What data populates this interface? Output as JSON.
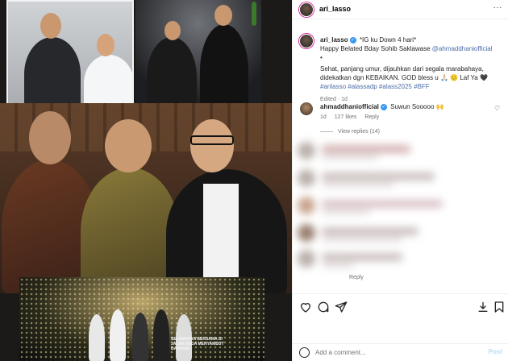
{
  "header": {
    "username": "ari_lasso",
    "more_label": "···"
  },
  "caption": {
    "username": "ari_lasso",
    "line1": "*IG ku Down 4 hari*",
    "line2_prefix": "Happy Belated Bday Sohib Saklawase ",
    "mention": "@ahmaddhaniofficial",
    "bullet": "•",
    "line3": "Sehat, panjang umur, dijauhkan dari segala marabahaya, didekatkan dgn KEBAIKAN. GOD bless u 🙏🏻 🙂 Laf Ya 🖤 ",
    "tags": "#arilasso #alassadp #alass2025 #BFF",
    "edited": "Edited · 1d"
  },
  "comment": {
    "username": "ahmaddhaniofficial",
    "text": "Suwun Sooooo 🙌",
    "time": "1d",
    "likes": "127 likes",
    "reply": "Reply",
    "view_replies": "View replies (14)"
  },
  "blurred_reply_label": "Reply",
  "media_caption": "SELAMANYA BERSAMA DI JALAN ANDA MENYAMBUT BAHAGIA",
  "add_comment": {
    "placeholder": "Add a comment...",
    "post_label": "Post"
  },
  "colors": {
    "link": "#4d6ea8",
    "verified": "#3897f0",
    "post": "#b2dffc"
  },
  "icons": [
    "heart-icon",
    "comment-icon",
    "share-icon",
    "save-icon",
    "emoji-icon",
    "more-icon"
  ]
}
